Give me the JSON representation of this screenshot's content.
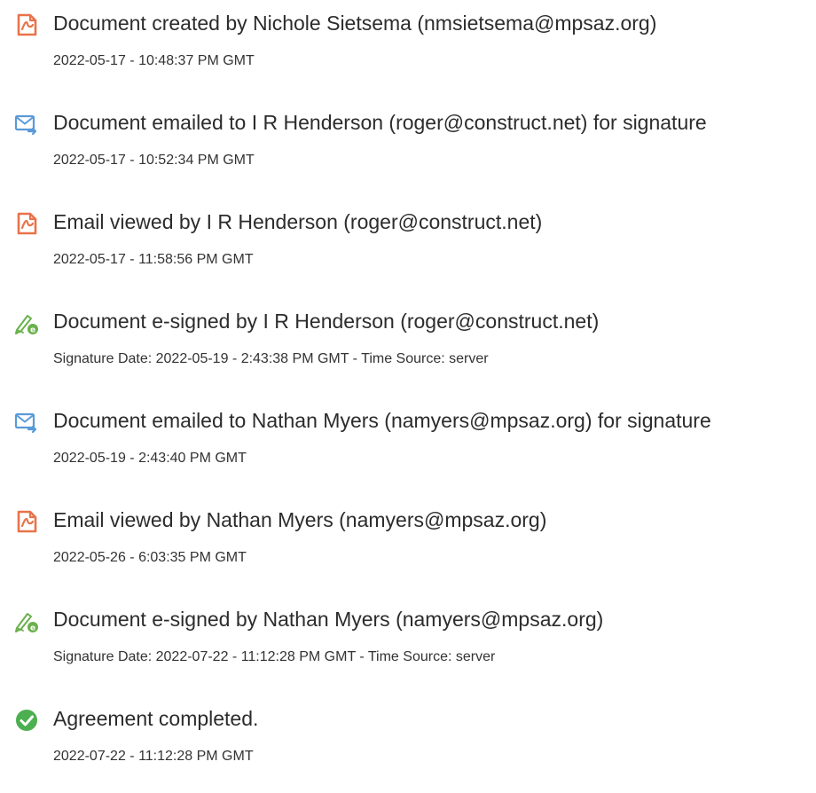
{
  "colors": {
    "pdf_icon": "#e8734a",
    "email_icon": "#5a9ad8",
    "sign_icon": "#6ab04c",
    "complete_icon": "#4caf50",
    "text": "#2c2c2c"
  },
  "events": [
    {
      "icon": "document-icon",
      "title": "Document created by Nichole Sietsema (nmsietsema@mpsaz.org)",
      "time": "2022-05-17 - 10:48:37 PM GMT"
    },
    {
      "icon": "email-sent-icon",
      "title": "Document emailed to I R Henderson (roger@construct.net) for signature",
      "time": "2022-05-17 - 10:52:34 PM GMT"
    },
    {
      "icon": "document-icon",
      "title": "Email viewed by I R Henderson (roger@construct.net)",
      "time": "2022-05-17 - 11:58:56 PM GMT"
    },
    {
      "icon": "e-sign-icon",
      "title": "Document e-signed by I R Henderson (roger@construct.net)",
      "time": "Signature Date: 2022-05-19 - 2:43:38 PM GMT - Time Source: server"
    },
    {
      "icon": "email-sent-icon",
      "title": "Document emailed to Nathan Myers (namyers@mpsaz.org) for signature",
      "time": "2022-05-19 - 2:43:40 PM GMT"
    },
    {
      "icon": "document-icon",
      "title": "Email viewed by Nathan Myers (namyers@mpsaz.org)",
      "time": "2022-05-26 - 6:03:35 PM GMT"
    },
    {
      "icon": "e-sign-icon",
      "title": "Document e-signed by Nathan Myers (namyers@mpsaz.org)",
      "time": "Signature Date: 2022-07-22 - 11:12:28 PM GMT - Time Source: server"
    },
    {
      "icon": "check-circle-icon",
      "title": "Agreement completed.",
      "time": "2022-07-22 - 11:12:28 PM GMT"
    }
  ]
}
